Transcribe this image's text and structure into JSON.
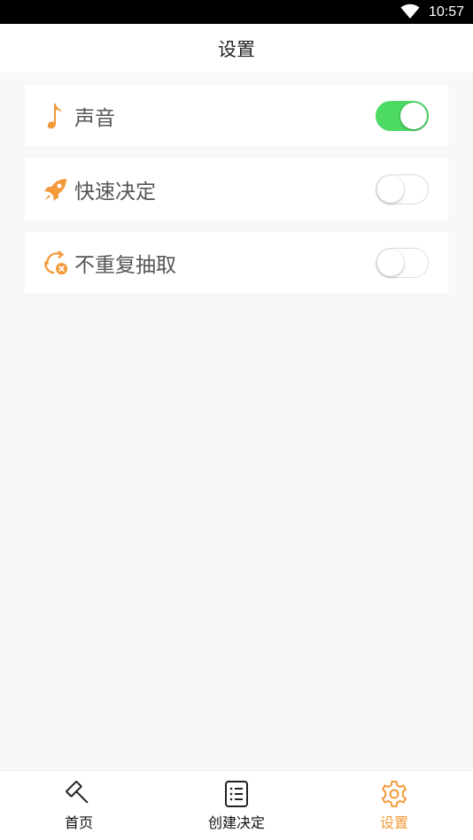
{
  "status_bar": {
    "time": "10:57"
  },
  "header": {
    "title": "设置"
  },
  "settings": [
    {
      "label": "声音",
      "icon": "music-note-icon",
      "enabled": true
    },
    {
      "label": "快速决定",
      "icon": "rocket-icon",
      "enabled": false
    },
    {
      "label": "不重复抽取",
      "icon": "no-repeat-icon",
      "enabled": false
    }
  ],
  "tabs": [
    {
      "label": "首页",
      "icon": "gavel-icon",
      "active": false
    },
    {
      "label": "创建决定",
      "icon": "list-icon",
      "active": false
    },
    {
      "label": "设置",
      "icon": "gear-icon",
      "active": true
    }
  ],
  "colors": {
    "accent": "#f39a3a",
    "toggle_on": "#4cd964"
  }
}
